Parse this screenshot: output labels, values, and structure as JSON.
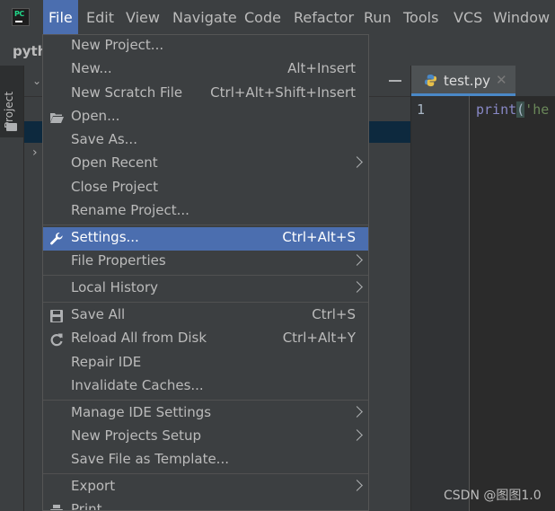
{
  "menubar": {
    "items": [
      "File",
      "Edit",
      "View",
      "Navigate",
      "Code",
      "Refactor",
      "Run",
      "Tools",
      "VCS",
      "Window"
    ]
  },
  "project": {
    "name": "pyth",
    "tool_window_label": "Project"
  },
  "editor": {
    "tab_label": "test.py",
    "line_number": "1",
    "code_keyword": "print",
    "code_paren": "(",
    "code_string": "'he"
  },
  "file_menu": {
    "items": [
      {
        "label": "New Project...",
        "shortcut": ""
      },
      {
        "label": "New...",
        "shortcut": "Alt+Insert"
      },
      {
        "label": "New Scratch File",
        "shortcut": "Ctrl+Alt+Shift+Insert"
      },
      {
        "label": "Open...",
        "shortcut": "",
        "icon": "folder-open-icon"
      },
      {
        "label": "Save As...",
        "shortcut": ""
      },
      {
        "label": "Open Recent",
        "shortcut": "",
        "submenu": true
      },
      {
        "label": "Close Project",
        "shortcut": ""
      },
      {
        "label": "Rename Project...",
        "shortcut": ""
      },
      {
        "label": "Settings...",
        "shortcut": "Ctrl+Alt+S",
        "icon": "wrench-icon",
        "highlighted": true
      },
      {
        "label": "File Properties",
        "shortcut": "",
        "submenu": true
      },
      {
        "label": "Local History",
        "shortcut": "",
        "submenu": true
      },
      {
        "label": "Save All",
        "shortcut": "Ctrl+S",
        "icon": "save-icon"
      },
      {
        "label": "Reload All from Disk",
        "shortcut": "Ctrl+Alt+Y",
        "icon": "reload-icon"
      },
      {
        "label": "Repair IDE",
        "shortcut": ""
      },
      {
        "label": "Invalidate Caches...",
        "shortcut": ""
      },
      {
        "label": "Manage IDE Settings",
        "shortcut": "",
        "submenu": true
      },
      {
        "label": "New Projects Setup",
        "shortcut": "",
        "submenu": true
      },
      {
        "label": "Save File as Template...",
        "shortcut": ""
      },
      {
        "label": "Export",
        "shortcut": "",
        "submenu": true
      },
      {
        "label": "Print...",
        "shortcut": "",
        "icon": "print-icon"
      }
    ]
  },
  "watermark": "CSDN @图图1.0",
  "colors": {
    "highlight": "#4b6eaf",
    "menu_bg": "#3c3f41",
    "editor_bg": "#2b2b2b"
  }
}
